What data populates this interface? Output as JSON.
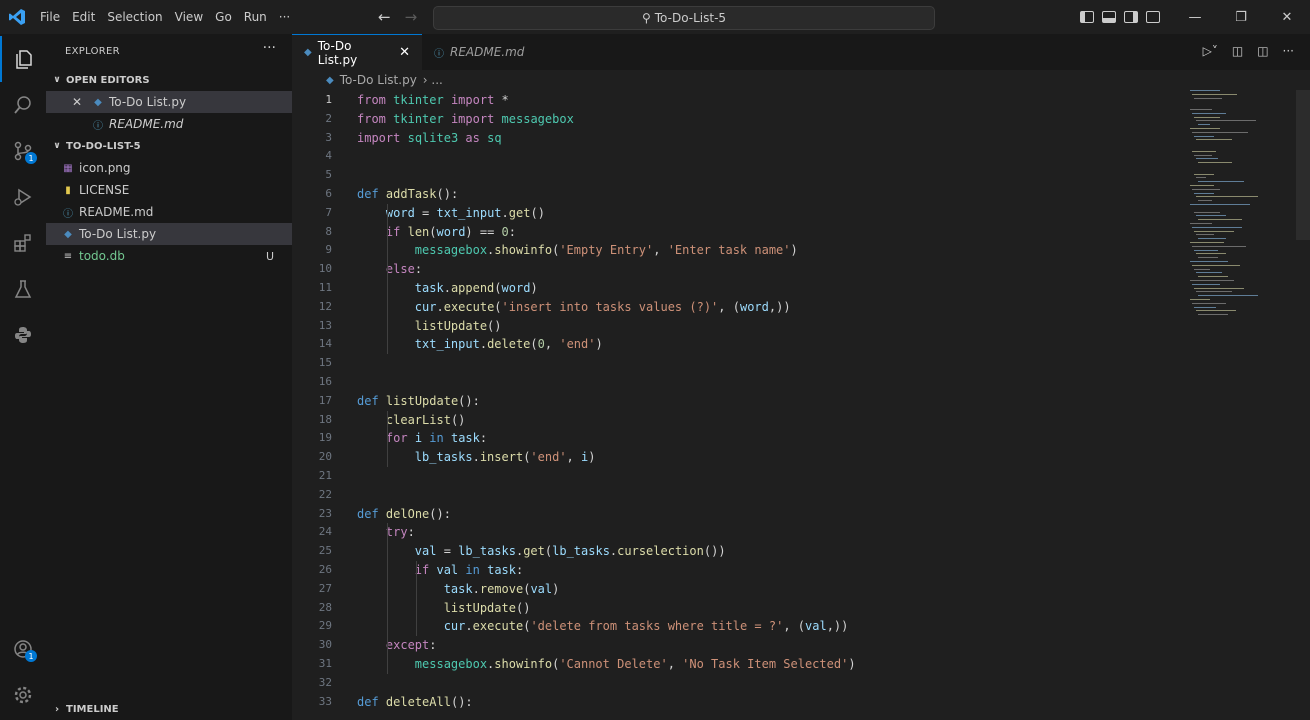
{
  "menu": [
    "File",
    "Edit",
    "Selection",
    "View",
    "Go",
    "Run",
    "···"
  ],
  "search": {
    "text": "To-Do-List-5"
  },
  "sidebar": {
    "title": "EXPLORER",
    "open_editors_label": "OPEN EDITORS",
    "open_editors": [
      {
        "label": "To-Do List.py",
        "icon": "python-icon"
      },
      {
        "label": "README.md",
        "icon": "info-icon"
      }
    ],
    "folder_label": "TO-DO-LIST-5",
    "files": [
      {
        "label": "icon.png",
        "icon": "image-icon",
        "status": ""
      },
      {
        "label": "LICENSE",
        "icon": "license-icon",
        "status": ""
      },
      {
        "label": "README.md",
        "icon": "info-icon",
        "status": ""
      },
      {
        "label": "To-Do List.py",
        "icon": "python-icon",
        "status": ""
      },
      {
        "label": "todo.db",
        "icon": "database-icon",
        "status": "U"
      }
    ],
    "timeline_label": "TIMELINE"
  },
  "tabs": [
    {
      "label": "To-Do List.py",
      "active": true
    },
    {
      "label": "README.md",
      "active": false
    }
  ],
  "breadcrumb": {
    "file": "To-Do List.py",
    "rest": "› ..."
  },
  "colors": {
    "keyword": "#569cd6",
    "function": "#dcdcaa",
    "string": "#ce9178",
    "variable": "#9cdcfe",
    "plain": "#d4d4d4",
    "number": "#b5cea8",
    "module": "#4ec9b0",
    "control": "#c586c0",
    "accent": "#0078d4"
  },
  "code_lines": [
    {
      "n": "1",
      "t": "from tkinter import *"
    },
    {
      "n": "2",
      "t": "from tkinter import messagebox"
    },
    {
      "n": "3",
      "t": "import sqlite3 as sq"
    },
    {
      "n": "4",
      "t": ""
    },
    {
      "n": "5",
      "t": ""
    },
    {
      "n": "6",
      "t": "def addTask():"
    },
    {
      "n": "7",
      "t": "    word = txt_input.get()"
    },
    {
      "n": "8",
      "t": "    if len(word) == 0:"
    },
    {
      "n": "9",
      "t": "        messagebox.showinfo('Empty Entry', 'Enter task name')"
    },
    {
      "n": "10",
      "t": "    else:"
    },
    {
      "n": "11",
      "t": "        task.append(word)"
    },
    {
      "n": "12",
      "t": "        cur.execute('insert into tasks values (?)', (word,))"
    },
    {
      "n": "13",
      "t": "        listUpdate()"
    },
    {
      "n": "14",
      "t": "        txt_input.delete(0, 'end')"
    },
    {
      "n": "15",
      "t": ""
    },
    {
      "n": "16",
      "t": ""
    },
    {
      "n": "17",
      "t": "def listUpdate():"
    },
    {
      "n": "18",
      "t": "    clearList()"
    },
    {
      "n": "19",
      "t": "    for i in task:"
    },
    {
      "n": "20",
      "t": "        lb_tasks.insert('end', i)"
    },
    {
      "n": "21",
      "t": ""
    },
    {
      "n": "22",
      "t": ""
    },
    {
      "n": "23",
      "t": "def delOne():"
    },
    {
      "n": "24",
      "t": "    try:"
    },
    {
      "n": "25",
      "t": "        val = lb_tasks.get(lb_tasks.curselection())"
    },
    {
      "n": "26",
      "t": "        if val in task:"
    },
    {
      "n": "27",
      "t": "            task.remove(val)"
    },
    {
      "n": "28",
      "t": "            listUpdate()"
    },
    {
      "n": "29",
      "t": "            cur.execute('delete from tasks where title = ?', (val,))"
    },
    {
      "n": "30",
      "t": "    except:"
    },
    {
      "n": "31",
      "t": "        messagebox.showinfo('Cannot Delete', 'No Task Item Selected')"
    },
    {
      "n": "32",
      "t": ""
    },
    {
      "n": "33",
      "t": "def deleteAll():"
    }
  ]
}
